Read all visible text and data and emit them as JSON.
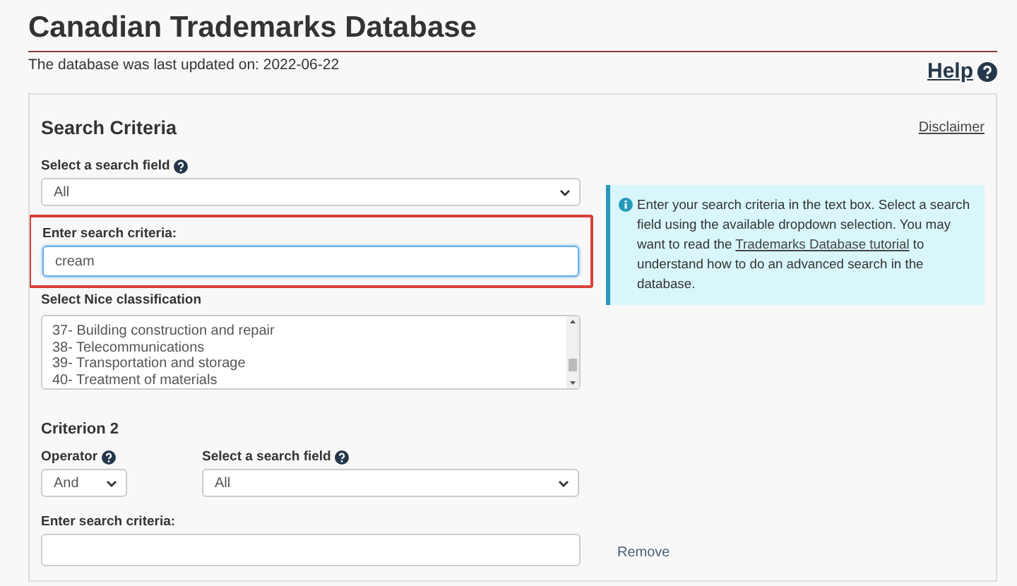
{
  "page": {
    "title": "Canadian Trademarks Database",
    "last_updated": "The database was last updated on: 2022-06-22",
    "help_link": "Help"
  },
  "search_panel": {
    "heading": "Search Criteria",
    "disclaimer_link": "Disclaimer",
    "criterion_1": {
      "field_label": "Select a search field",
      "field_value": "All",
      "criteria_label": "Enter search criteria:",
      "criteria_value": "cream",
      "highlighted": true,
      "focused": true
    },
    "nice_classification": {
      "label": "Select Nice classification",
      "items": [
        {
          "label": "37- Building construction and repair",
          "selected": false
        },
        {
          "label": "38- Telecommunications",
          "selected": false
        },
        {
          "label": "39- Transportation and storage",
          "selected": false
        },
        {
          "label": "40- Treatment of materials",
          "selected": false
        }
      ]
    },
    "info": {
      "text_before": "Enter your search criteria in the text box. Select a search field using the available dropdown selection. You may want to read the",
      "link": "Trademarks Database tutorial",
      "text_after": "to understand how to do an advanced search in the database."
    },
    "criterion_2": {
      "heading": "Criterion 2",
      "operator_label": "Operator",
      "operator_value": "And",
      "field_label": "Select a search field",
      "field_value": "All",
      "criteria_label": "Enter search criteria:",
      "remove_link": "Remove"
    }
  }
}
